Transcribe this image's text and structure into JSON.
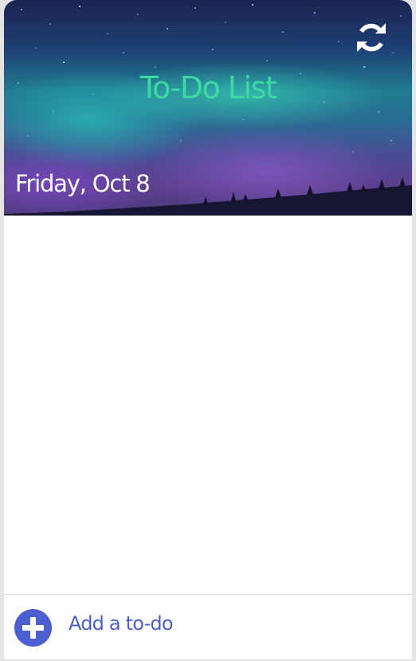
{
  "header": {
    "title": "To-Do List",
    "date": "Friday, Oct 8",
    "refresh_icon": "refresh-icon"
  },
  "todos": [],
  "footer": {
    "add_icon": "plus-circle-icon",
    "add_label": "Add a to-do"
  },
  "colors": {
    "title": "#3fd8a4",
    "accent": "#4b5fd1",
    "date": "#ffffff"
  }
}
